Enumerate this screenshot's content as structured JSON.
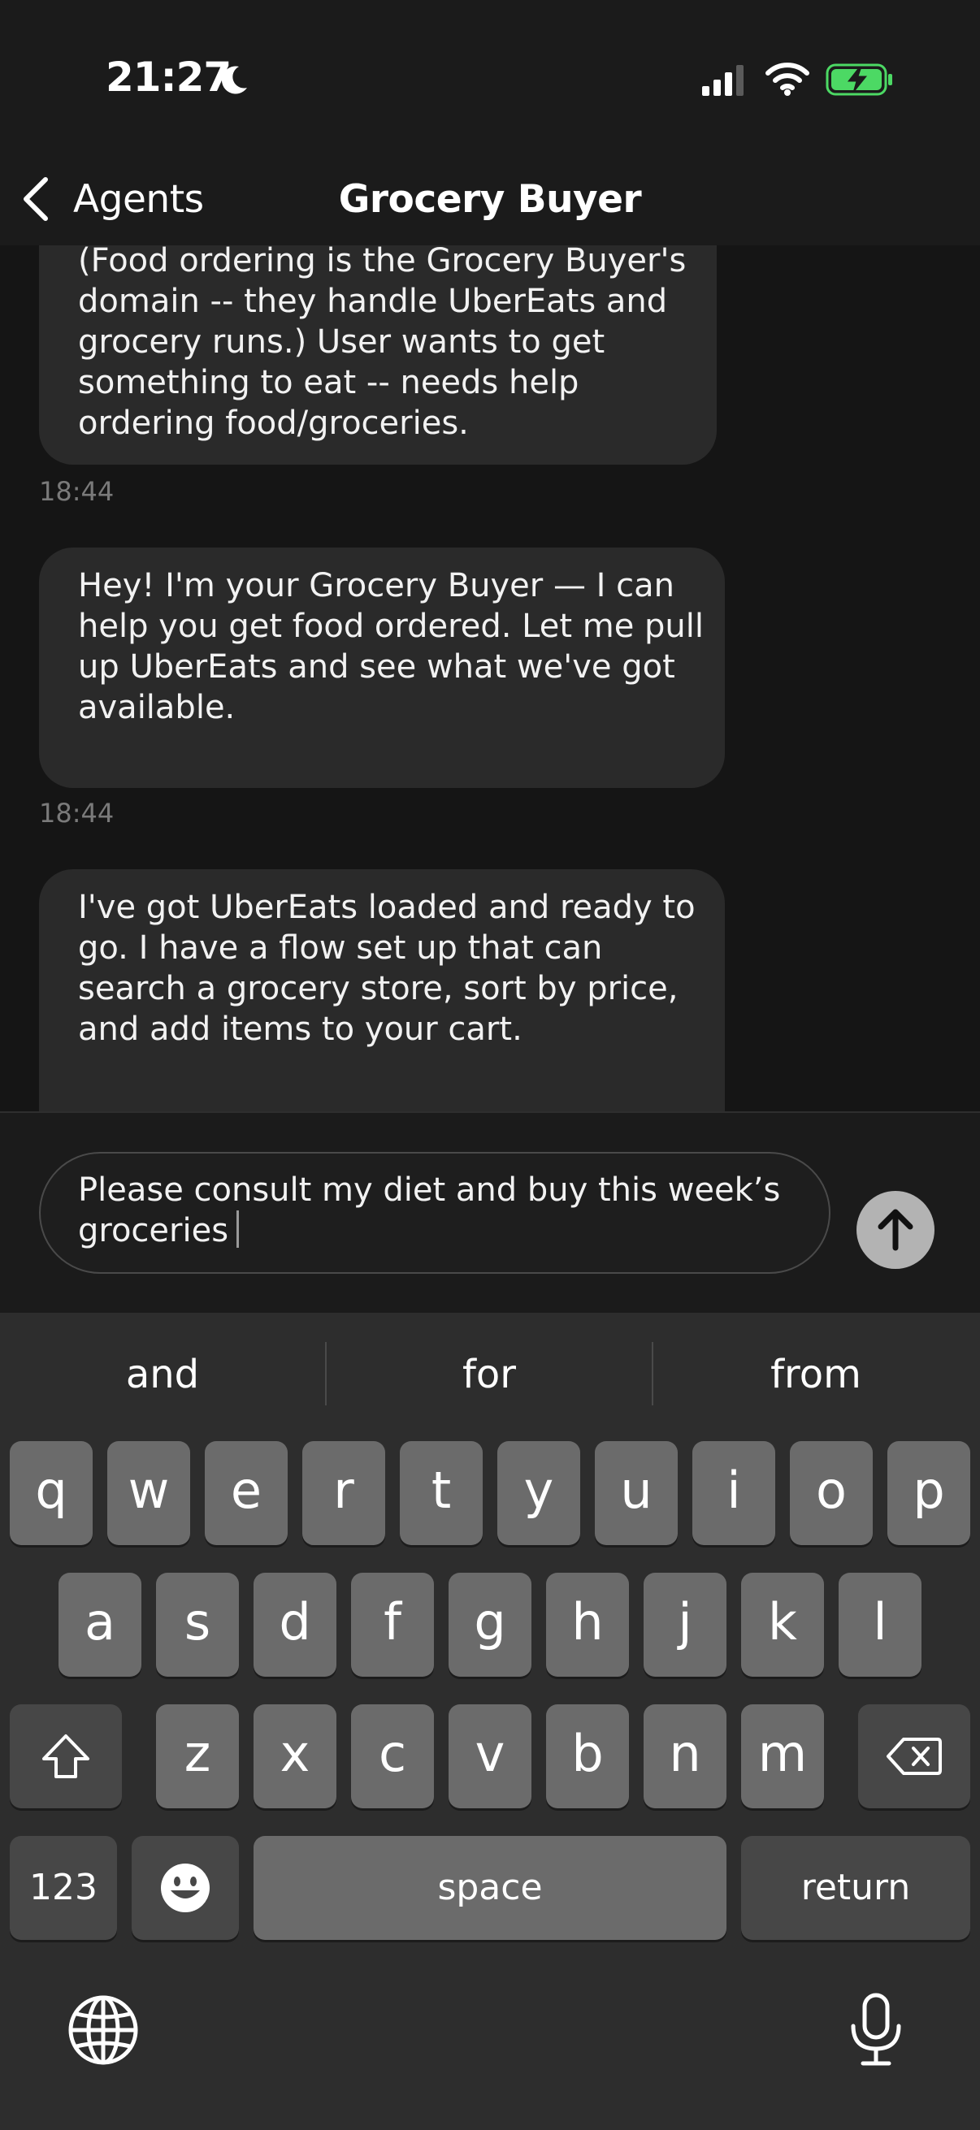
{
  "status_bar": {
    "time": "21:27",
    "icons": [
      "moon-icon",
      "signal-icon",
      "wifi-icon",
      "battery-charging-icon"
    ],
    "battery_color": "#4cd964"
  },
  "nav": {
    "back_label": "Agents",
    "title": "Grocery Buyer"
  },
  "messages": [
    {
      "lines": [
        "(Food ordering is the Grocery Buyer's",
        "domain -- they handle UberEats and",
        "grocery runs.) User wants to get",
        "something to eat -- needs help",
        "ordering food/groceries."
      ],
      "time": "18:44"
    },
    {
      "lines": [
        "Hey! I'm your Grocery Buyer — I can",
        "help you get food ordered. Let me pull",
        "up UberEats and see what we've got",
        "available."
      ],
      "time": "18:44"
    },
    {
      "lines": [
        "I've got UberEats loaded and ready to",
        "go. I have a flow set up that can",
        "search a grocery store, sort by price,",
        "and add items to your cart."
      ]
    }
  ],
  "composer": {
    "value_lines": [
      "Please consult my diet and buy this week’s",
      "groceries"
    ],
    "send_icon": "arrow-up-icon"
  },
  "keyboard": {
    "suggestions": [
      "and",
      "for",
      "from"
    ],
    "row1": [
      "q",
      "w",
      "e",
      "r",
      "t",
      "y",
      "u",
      "i",
      "o",
      "p"
    ],
    "row2": [
      "a",
      "s",
      "d",
      "f",
      "g",
      "h",
      "j",
      "k",
      "l"
    ],
    "row3": [
      "z",
      "x",
      "c",
      "v",
      "b",
      "n",
      "m"
    ],
    "numbers_label": "123",
    "space_label": "space",
    "return_label": "return",
    "icons": [
      "shift-icon",
      "backspace-icon",
      "emoji-icon",
      "globe-icon",
      "microphone-icon"
    ]
  }
}
